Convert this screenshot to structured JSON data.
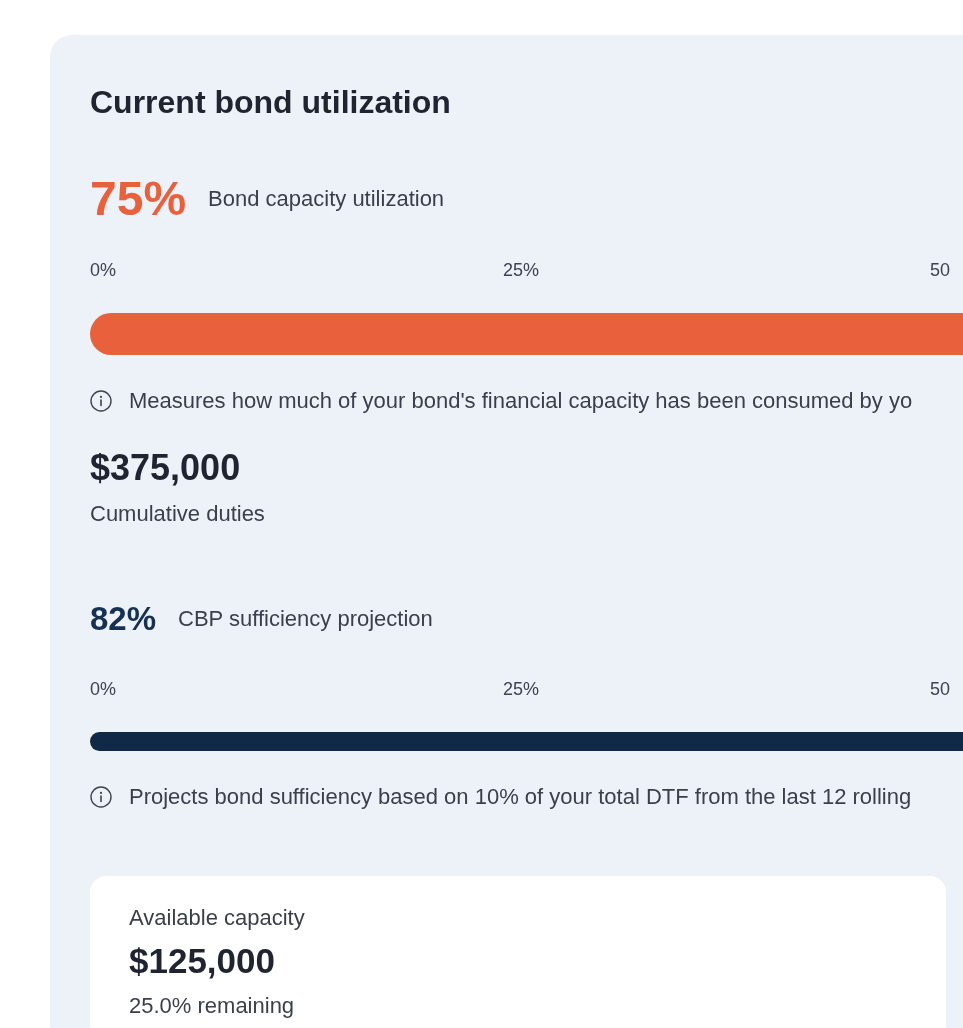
{
  "card": {
    "title": "Current bond utilization"
  },
  "utilization": {
    "value": "75%",
    "label": "Bond capacity utilization",
    "ticks": [
      "0%",
      "25%",
      "50"
    ],
    "level": 0.75,
    "note": "Measures how much of your bond's financial capacity has been consumed by yo"
  },
  "cumulative_duties": {
    "value": "$375,000",
    "label": "Cumulative duties"
  },
  "sufficiency": {
    "value": "82%",
    "label": "CBP sufficiency projection",
    "ticks": [
      "0%",
      "25%",
      "50"
    ],
    "level": 0.82,
    "note": "Projects bond sufficiency based on 10% of your total DTF from the last 12 rolling"
  },
  "available_capacity": {
    "label": "Available capacity",
    "value": "$125,000",
    "remaining": "25.0% remaining"
  }
}
